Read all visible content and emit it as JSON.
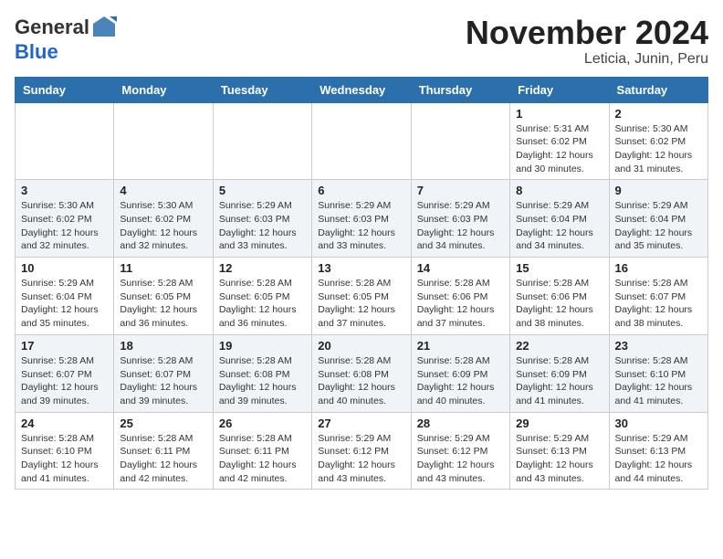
{
  "header": {
    "logo_general": "General",
    "logo_blue": "Blue",
    "month_title": "November 2024",
    "location": "Leticia, Junin, Peru"
  },
  "weekdays": [
    "Sunday",
    "Monday",
    "Tuesday",
    "Wednesday",
    "Thursday",
    "Friday",
    "Saturday"
  ],
  "weeks": [
    [
      {
        "day": "",
        "info": ""
      },
      {
        "day": "",
        "info": ""
      },
      {
        "day": "",
        "info": ""
      },
      {
        "day": "",
        "info": ""
      },
      {
        "day": "",
        "info": ""
      },
      {
        "day": "1",
        "info": "Sunrise: 5:31 AM\nSunset: 6:02 PM\nDaylight: 12 hours and 30 minutes."
      },
      {
        "day": "2",
        "info": "Sunrise: 5:30 AM\nSunset: 6:02 PM\nDaylight: 12 hours and 31 minutes."
      }
    ],
    [
      {
        "day": "3",
        "info": "Sunrise: 5:30 AM\nSunset: 6:02 PM\nDaylight: 12 hours and 32 minutes."
      },
      {
        "day": "4",
        "info": "Sunrise: 5:30 AM\nSunset: 6:02 PM\nDaylight: 12 hours and 32 minutes."
      },
      {
        "day": "5",
        "info": "Sunrise: 5:29 AM\nSunset: 6:03 PM\nDaylight: 12 hours and 33 minutes."
      },
      {
        "day": "6",
        "info": "Sunrise: 5:29 AM\nSunset: 6:03 PM\nDaylight: 12 hours and 33 minutes."
      },
      {
        "day": "7",
        "info": "Sunrise: 5:29 AM\nSunset: 6:03 PM\nDaylight: 12 hours and 34 minutes."
      },
      {
        "day": "8",
        "info": "Sunrise: 5:29 AM\nSunset: 6:04 PM\nDaylight: 12 hours and 34 minutes."
      },
      {
        "day": "9",
        "info": "Sunrise: 5:29 AM\nSunset: 6:04 PM\nDaylight: 12 hours and 35 minutes."
      }
    ],
    [
      {
        "day": "10",
        "info": "Sunrise: 5:29 AM\nSunset: 6:04 PM\nDaylight: 12 hours and 35 minutes."
      },
      {
        "day": "11",
        "info": "Sunrise: 5:28 AM\nSunset: 6:05 PM\nDaylight: 12 hours and 36 minutes."
      },
      {
        "day": "12",
        "info": "Sunrise: 5:28 AM\nSunset: 6:05 PM\nDaylight: 12 hours and 36 minutes."
      },
      {
        "day": "13",
        "info": "Sunrise: 5:28 AM\nSunset: 6:05 PM\nDaylight: 12 hours and 37 minutes."
      },
      {
        "day": "14",
        "info": "Sunrise: 5:28 AM\nSunset: 6:06 PM\nDaylight: 12 hours and 37 minutes."
      },
      {
        "day": "15",
        "info": "Sunrise: 5:28 AM\nSunset: 6:06 PM\nDaylight: 12 hours and 38 minutes."
      },
      {
        "day": "16",
        "info": "Sunrise: 5:28 AM\nSunset: 6:07 PM\nDaylight: 12 hours and 38 minutes."
      }
    ],
    [
      {
        "day": "17",
        "info": "Sunrise: 5:28 AM\nSunset: 6:07 PM\nDaylight: 12 hours and 39 minutes."
      },
      {
        "day": "18",
        "info": "Sunrise: 5:28 AM\nSunset: 6:07 PM\nDaylight: 12 hours and 39 minutes."
      },
      {
        "day": "19",
        "info": "Sunrise: 5:28 AM\nSunset: 6:08 PM\nDaylight: 12 hours and 39 minutes."
      },
      {
        "day": "20",
        "info": "Sunrise: 5:28 AM\nSunset: 6:08 PM\nDaylight: 12 hours and 40 minutes."
      },
      {
        "day": "21",
        "info": "Sunrise: 5:28 AM\nSunset: 6:09 PM\nDaylight: 12 hours and 40 minutes."
      },
      {
        "day": "22",
        "info": "Sunrise: 5:28 AM\nSunset: 6:09 PM\nDaylight: 12 hours and 41 minutes."
      },
      {
        "day": "23",
        "info": "Sunrise: 5:28 AM\nSunset: 6:10 PM\nDaylight: 12 hours and 41 minutes."
      }
    ],
    [
      {
        "day": "24",
        "info": "Sunrise: 5:28 AM\nSunset: 6:10 PM\nDaylight: 12 hours and 41 minutes."
      },
      {
        "day": "25",
        "info": "Sunrise: 5:28 AM\nSunset: 6:11 PM\nDaylight: 12 hours and 42 minutes."
      },
      {
        "day": "26",
        "info": "Sunrise: 5:28 AM\nSunset: 6:11 PM\nDaylight: 12 hours and 42 minutes."
      },
      {
        "day": "27",
        "info": "Sunrise: 5:29 AM\nSunset: 6:12 PM\nDaylight: 12 hours and 43 minutes."
      },
      {
        "day": "28",
        "info": "Sunrise: 5:29 AM\nSunset: 6:12 PM\nDaylight: 12 hours and 43 minutes."
      },
      {
        "day": "29",
        "info": "Sunrise: 5:29 AM\nSunset: 6:13 PM\nDaylight: 12 hours and 43 minutes."
      },
      {
        "day": "30",
        "info": "Sunrise: 5:29 AM\nSunset: 6:13 PM\nDaylight: 12 hours and 44 minutes."
      }
    ]
  ]
}
